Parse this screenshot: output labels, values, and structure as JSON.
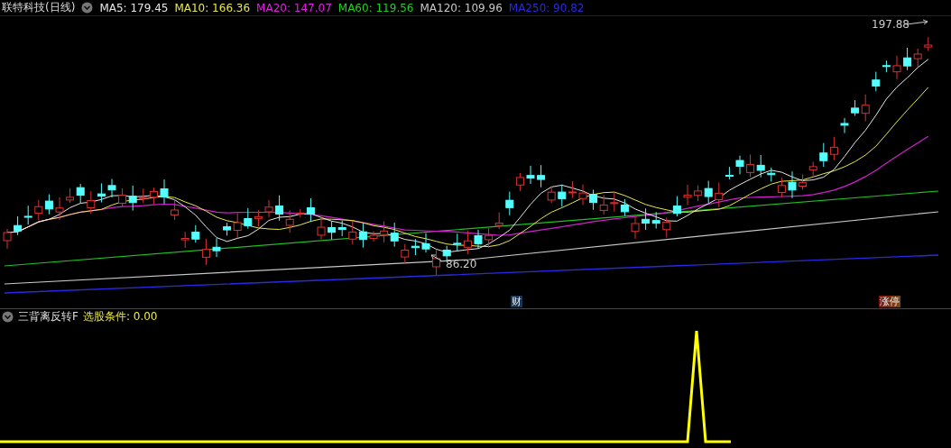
{
  "title": "联特科技(日线)",
  "moving_averages": [
    {
      "label": "MA5: 179.45",
      "color": "#e6e6e6"
    },
    {
      "label": "MA10: 166.36",
      "color": "#e8e84a"
    },
    {
      "label": "MA20: 147.07",
      "color": "#e020e0"
    },
    {
      "label": "MA60: 119.56",
      "color": "#20d020"
    },
    {
      "label": "MA120: 109.96",
      "color": "#c8c8c8"
    },
    {
      "label": "MA250: 90.82",
      "color": "#2a2ae0"
    }
  ],
  "high_label": "197.88",
  "low_label": "86.20",
  "event_markers": [
    {
      "text": "财",
      "kind": "finance"
    },
    {
      "text": "涨停",
      "kind": "limit-up"
    }
  ],
  "indicator": {
    "name": "三背离反转F",
    "condition": "选股条件: 0.00"
  }
}
